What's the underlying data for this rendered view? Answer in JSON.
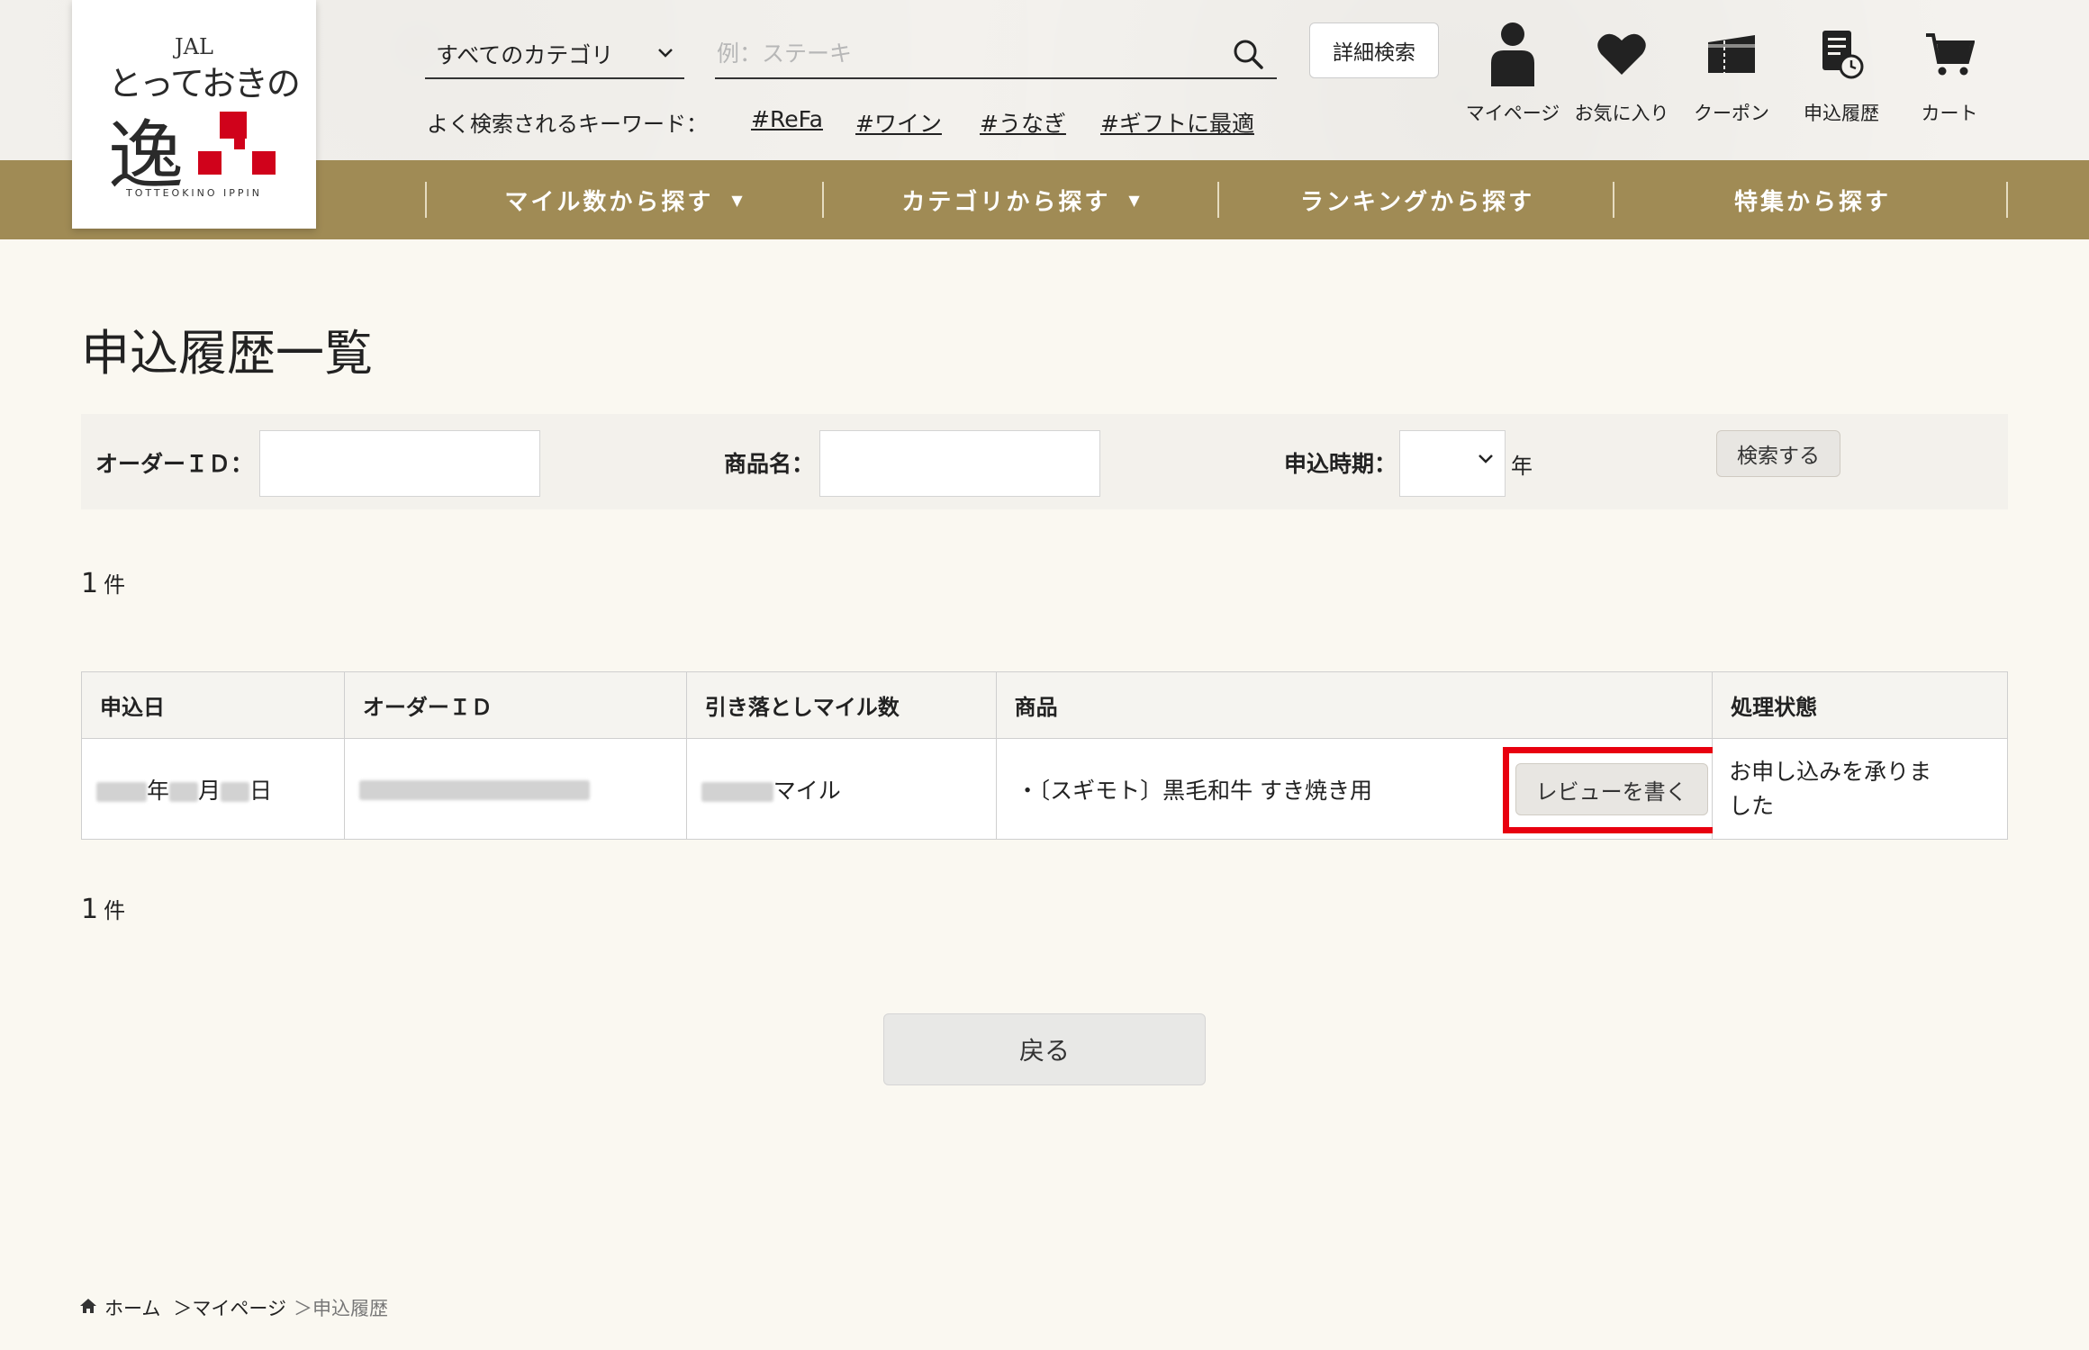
{
  "header": {
    "logo": {
      "brand": "JAL",
      "line1": "とっておきの",
      "line2": "逸",
      "sub": "TOTTEOKINO IPPIN"
    },
    "category_select": "すべてのカテゴリ",
    "search_placeholder": "例：ステーキ",
    "advanced_search": "詳細検索",
    "keyword_label": "よく検索されるキーワード：",
    "keywords": [
      "#ReFa",
      "#ワイン",
      "#うなぎ",
      "#ギフトに最適"
    ],
    "icons": [
      {
        "label": "マイページ",
        "icon": "person-icon"
      },
      {
        "label": "お気に入り",
        "icon": "heart-icon"
      },
      {
        "label": "クーポン",
        "icon": "coupon-icon"
      },
      {
        "label": "申込履歴",
        "icon": "history-icon"
      },
      {
        "label": "カート",
        "icon": "cart-icon"
      }
    ]
  },
  "nav": {
    "items": [
      "マイル数から探す",
      "カテゴリから探す",
      "ランキングから探す",
      "特集から探す"
    ]
  },
  "page": {
    "title": "申込履歴一覧",
    "filter": {
      "order_id_label": "オーダーＩＤ：",
      "product_label": "商品名：",
      "period_label": "申込時期：",
      "year_suffix": "年",
      "search_button": "検索する"
    },
    "count_top": "1",
    "count_bottom": "1",
    "count_unit": "件",
    "table": {
      "headers": [
        "申込日",
        "オーダーＩＤ",
        "引き落としマイル数",
        "商品",
        "処理状態"
      ],
      "row": {
        "date_year": "年",
        "date_month": "月",
        "date_day": "日",
        "miles_unit": "マイル",
        "product": "・〔スギモト〕黒毛和牛 すき焼き用",
        "review_button": "レビューを書く",
        "status": "お申し込みを承りました"
      }
    },
    "back_button": "戻る"
  },
  "breadcrumb": {
    "home": "ホーム",
    "mypage": "＞マイページ",
    "current": "＞申込履歴"
  },
  "colors": {
    "nav_bg": "#a08b55",
    "highlight": "#e8000f",
    "logo_red": "#d0021b"
  }
}
